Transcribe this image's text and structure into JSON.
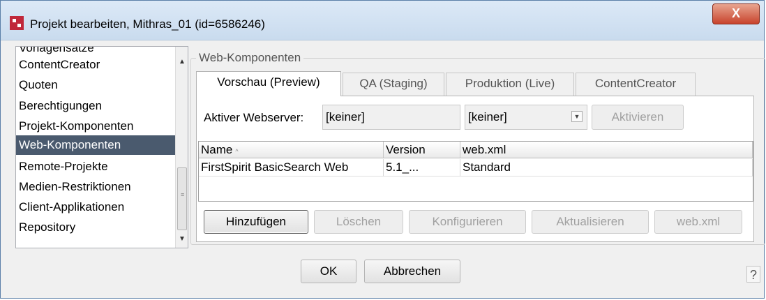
{
  "window": {
    "title": "Projekt bearbeiten, Mithras_01 (id=6586246)",
    "close_label": "X"
  },
  "sidebar": {
    "items": [
      {
        "label": "Vorlagensätze"
      },
      {
        "label": "ContentCreator"
      },
      {
        "label": "Quoten"
      },
      {
        "label": "Berechtigungen"
      },
      {
        "label": "Projekt-Komponenten"
      },
      {
        "label": "Web-Komponenten",
        "selected": true
      },
      {
        "label": "Remote-Projekte"
      },
      {
        "label": "Medien-Restriktionen"
      },
      {
        "label": "Client-Applikationen"
      },
      {
        "label": "Repository"
      }
    ]
  },
  "group": {
    "title": "Web-Komponenten"
  },
  "tabs": [
    {
      "label": "Vorschau (Preview)",
      "active": true
    },
    {
      "label": "QA (Staging)"
    },
    {
      "label": "Produktion (Live)"
    },
    {
      "label": "ContentCreator"
    }
  ],
  "webserver": {
    "label": "Aktiver Webserver:",
    "value": "[keiner]",
    "select_value": "[keiner]",
    "activate_label": "Aktivieren"
  },
  "table": {
    "columns": [
      "Name",
      "Version",
      "web.xml"
    ],
    "rows": [
      [
        "FirstSpirit BasicSearch Web",
        "5.1_...",
        "Standard"
      ]
    ]
  },
  "actions": {
    "add": "Hinzufügen",
    "delete": "Löschen",
    "configure": "Konfigurieren",
    "update": "Aktualisieren",
    "webxml": "web.xml"
  },
  "footer": {
    "ok": "OK",
    "cancel": "Abbrechen",
    "help": "?"
  },
  "colors": {
    "selection": "#4a5a6e",
    "close_button": "#c8432c",
    "brand_icon": "#c0283b"
  }
}
